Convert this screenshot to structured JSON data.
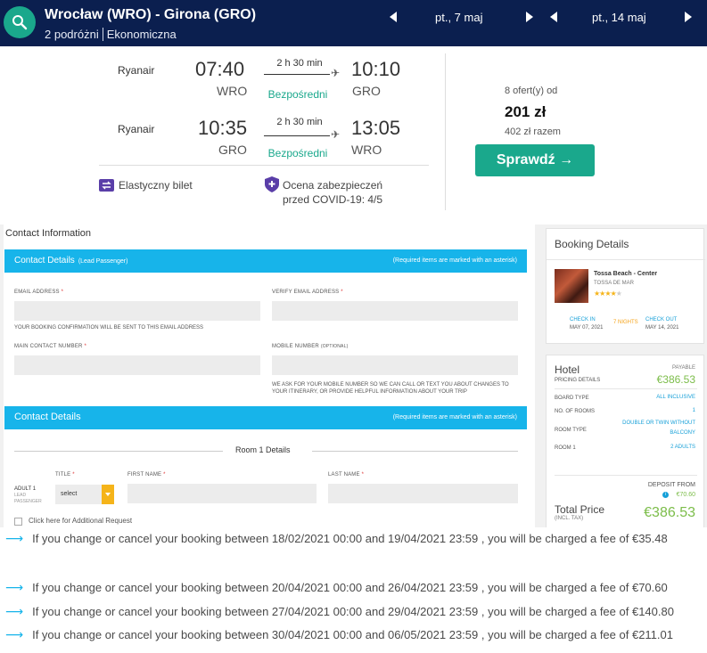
{
  "search": {
    "route": "Wrocław (WRO) - Girona (GRO)",
    "passengers": "2 podróżni",
    "cabin": "Ekonomiczna",
    "outbound_date": "pt., 7 maj",
    "return_date": "pt., 14 maj"
  },
  "flights": [
    {
      "airline": "Ryanair",
      "dep_time": "07:40",
      "dep_code": "WRO",
      "duration": "2 h 30 min",
      "stops": "Bezpośredni",
      "arr_time": "10:10",
      "arr_code": "GRO"
    },
    {
      "airline": "Ryanair",
      "dep_time": "10:35",
      "dep_code": "GRO",
      "duration": "2 h 30 min",
      "stops": "Bezpośredni",
      "arr_time": "13:05",
      "arr_code": "WRO"
    }
  ],
  "perks": {
    "flexible": "Elastyczny bilet",
    "covid_line1": "Ocena zabezpieczeń",
    "covid_line2": "przed COVID-19: 4/5"
  },
  "offer": {
    "offers": "8 ofert(y) od",
    "price": "201 zł",
    "total": "402 zł razem",
    "cta": "Sprawdź →"
  },
  "form": {
    "title": "Contact Information",
    "section1_title": "Contact Details",
    "section1_sub": "(Lead Passenger)",
    "required_note": "(Required items are marked with an asterisk)",
    "email_label": "EMAIL ADDRESS",
    "verify_email_label": "VERIFY EMAIL ADDRESS",
    "email_note": "YOUR BOOKING CONFIRMATION WILL BE SENT TO THIS EMAIL ADDRESS",
    "main_contact_label": "MAIN CONTACT NUMBER",
    "mobile_label": "MOBILE NUMBER",
    "mobile_optional": "(OPTIONAL)",
    "mobile_note_1": "WE ASK FOR YOUR MOBILE NUMBER SO WE CAN CALL OR TEXT YOU ABOUT CHANGES TO",
    "mobile_note_2": "YOUR ITINERARY, OR PROVIDE HELPFUL INFORMATION ABOUT YOUR TRIP",
    "section2_title": "Contact Details",
    "room_title": "Room 1 Details",
    "adult_line1": "ADULT 1",
    "adult_line2": "LEAD",
    "adult_line3": "PASSENGER",
    "title_label": "TITLE",
    "title_value": "select",
    "first_name_label": "FIRST NAME",
    "last_name_label": "LAST NAME",
    "additional_request": "Click here for Additional Request",
    "asterisk": "*"
  },
  "booking_details": {
    "title": "Booking Details",
    "hotel_name": "Tossa Beach - Center",
    "hotel_location": "TOSSA DE MAR",
    "stars": 4,
    "stars_on": "★★★★",
    "stars_off": "★",
    "check_in_label": "CHECK IN",
    "check_in_date": "MAY 07, 2021",
    "nights": "7 NIGHTS",
    "check_out_label": "CHECK OUT",
    "check_out_date": "MAY 14, 2021"
  },
  "pricing": {
    "hotel_label": "Hotel",
    "payable_label": "PAYABLE",
    "pricing_details_label": "PRICING DETAILS",
    "hotel_amount": "€386.53",
    "board_type_label": "BOARD TYPE",
    "board_type": "ALL INCLUSIVE",
    "rooms_label": "NO. OF ROOMS",
    "rooms": "1",
    "room_type_label": "ROOM TYPE",
    "room_type_1": "DOUBLE OR TWIN WITHOUT",
    "room_type_2": "BALCONY",
    "room1_label": "ROOM 1",
    "room1_value": "2 ADULTS",
    "deposit_label": "DEPOSIT FROM",
    "deposit_value": "€70.60",
    "total_label": "Total Price",
    "total_tax": "(INCL. TAX)",
    "total_amount": "€386.53"
  },
  "fees": [
    "If you change or cancel your booking between 18/02/2021 00:00 and 19/04/2021 23:59 , you will be charged a fee of €35.48",
    "If you change or cancel your booking between 20/04/2021 00:00 and 26/04/2021 23:59 , you will be charged a fee of €70.60",
    "If you change or cancel your booking between 27/04/2021 00:00 and 29/04/2021 23:59 , you will be charged a fee of €140.80",
    "If you change or cancel your booking between 30/04/2021 00:00 and 06/05/2021 23:59 , you will be charged a fee of €211.01"
  ],
  "colors": {
    "topbar": "#0b1f4f",
    "accent_green": "#1aa88c",
    "form_blue": "#17b4ea",
    "price_green": "#7cbd4a"
  }
}
